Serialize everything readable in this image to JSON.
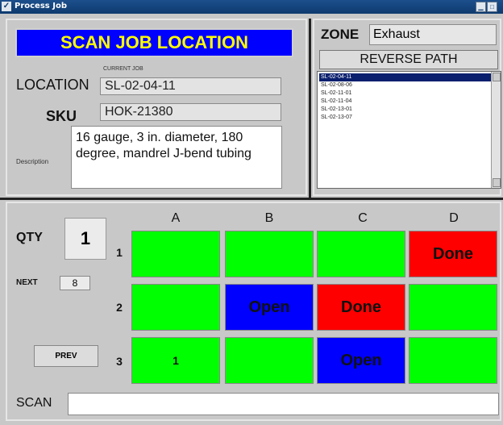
{
  "window": {
    "title": "Process Job",
    "titlebar_icon": "checkmark-icon",
    "buttons": [
      "minimize-icon",
      "maximize-icon",
      "close-icon"
    ]
  },
  "banner": "SCAN JOB LOCATION",
  "current_job_label": "CURRENT JOB",
  "location": {
    "label": "LOCATION",
    "value": "SL-02-04-11"
  },
  "sku": {
    "label": "SKU",
    "value": "HOK-21380"
  },
  "description": {
    "label": "Description",
    "value": "16 gauge, 3 in. diameter, 180 degree, mandrel J-bend tubing"
  },
  "zone": {
    "label": "ZONE",
    "value": "Exhaust"
  },
  "reverse_path_label": "REVERSE PATH",
  "locations_list": [
    "SL-02-04-11",
    "SL-02-08-06",
    "SL-02-11-01",
    "SL-02-11-04",
    "SL-02-13-01",
    "SL-02-13-07"
  ],
  "qty": {
    "label": "QTY",
    "value": "1"
  },
  "next": {
    "label": "NEXT",
    "value": "8"
  },
  "prev_label": "PREV",
  "grid": {
    "columns": [
      "A",
      "B",
      "C",
      "D"
    ],
    "rows": [
      "1",
      "2",
      "3"
    ],
    "cells": [
      [
        {
          "state": "green",
          "text": ""
        },
        {
          "state": "green",
          "text": ""
        },
        {
          "state": "green",
          "text": ""
        },
        {
          "state": "red",
          "text": "Done"
        }
      ],
      [
        {
          "state": "green",
          "text": ""
        },
        {
          "state": "blue",
          "text": "Open"
        },
        {
          "state": "red",
          "text": "Done"
        },
        {
          "state": "green",
          "text": ""
        }
      ],
      [
        {
          "state": "green",
          "text": "1"
        },
        {
          "state": "green",
          "text": ""
        },
        {
          "state": "blue",
          "text": "Open"
        },
        {
          "state": "green",
          "text": ""
        }
      ]
    ],
    "colors": {
      "green": "#00ff00",
      "blue": "#0000ff",
      "red": "#ff0000"
    }
  },
  "scan": {
    "label": "SCAN",
    "value": ""
  }
}
